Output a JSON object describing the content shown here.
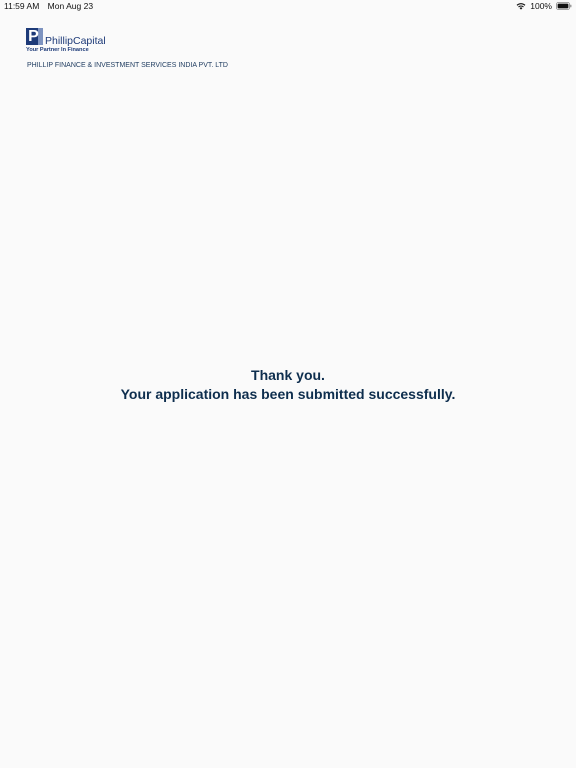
{
  "status_bar": {
    "time": "11:59 AM",
    "date": "Mon Aug 23",
    "battery": "100%"
  },
  "logo": {
    "mark_letter": "P",
    "name": "PhillipCapital",
    "tagline": "Your Partner In Finance"
  },
  "company_name": "PHILLIP FINANCE & INVESTMENT SERVICES INDIA PVT. LTD",
  "confirmation": {
    "line1": "Thank you.",
    "line2": "Your application has been submitted successfully."
  },
  "icons": {
    "wifi": "wifi-icon",
    "battery": "battery-icon"
  },
  "colors": {
    "background": "#fafafa",
    "brand_blue": "#1d3a78",
    "heading_text": "#0e2e4e"
  }
}
